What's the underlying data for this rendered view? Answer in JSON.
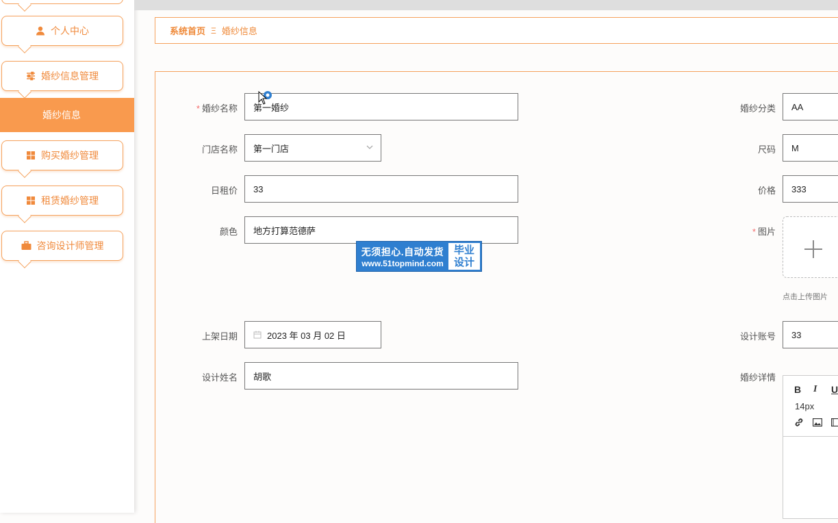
{
  "sidebar": {
    "items": [
      {
        "label": "个人中心",
        "icon": "user-icon"
      },
      {
        "label": "婚纱信息管理",
        "icon": "sliders-icon"
      },
      {
        "label": "购买婚纱管理",
        "icon": "grid-icon"
      },
      {
        "label": "租赁婚纱管理",
        "icon": "grid-icon"
      },
      {
        "label": "咨询设计师管理",
        "icon": "briefcase-icon"
      }
    ],
    "active_item": "婚纱信息"
  },
  "breadcrumb": {
    "home": "系统首页",
    "separator": "Ξ",
    "current": "婚纱信息"
  },
  "form": {
    "left": [
      {
        "label": "婚纱名称",
        "required": true,
        "value": "第一婚纱"
      },
      {
        "label": "门店名称",
        "required": false,
        "value": "第一门店"
      },
      {
        "label": "日租价",
        "required": false,
        "value": "33"
      },
      {
        "label": "颜色",
        "required": false,
        "value": "地方打算范德萨"
      },
      {
        "label": "上架日期",
        "required": false,
        "value": "2023 年 03 月 02 日"
      },
      {
        "label": "设计姓名",
        "required": false,
        "value": "胡歌"
      }
    ],
    "right": [
      {
        "label": "婚纱分类",
        "required": false,
        "value": "AA"
      },
      {
        "label": "尺码",
        "required": false,
        "value": "M"
      },
      {
        "label": "价格",
        "required": false,
        "value": "333"
      },
      {
        "label": "图片",
        "required": true
      },
      {
        "label": "设计账号",
        "required": false,
        "value": "33"
      },
      {
        "label": "婚纱详情",
        "required": false
      }
    ],
    "upload_hint": "点击上传图片",
    "editor": {
      "bold": "B",
      "italic": "I",
      "underline": "U",
      "font_size": "14px"
    }
  },
  "watermark": {
    "line1": "无须担心.自动发货",
    "line2": "www.51topmind.com",
    "badge_1": "毕业",
    "badge_2": "设计"
  },
  "colors": {
    "accent": "#f99a4e",
    "border": "#f5a15c",
    "required": "#f56c6c"
  }
}
